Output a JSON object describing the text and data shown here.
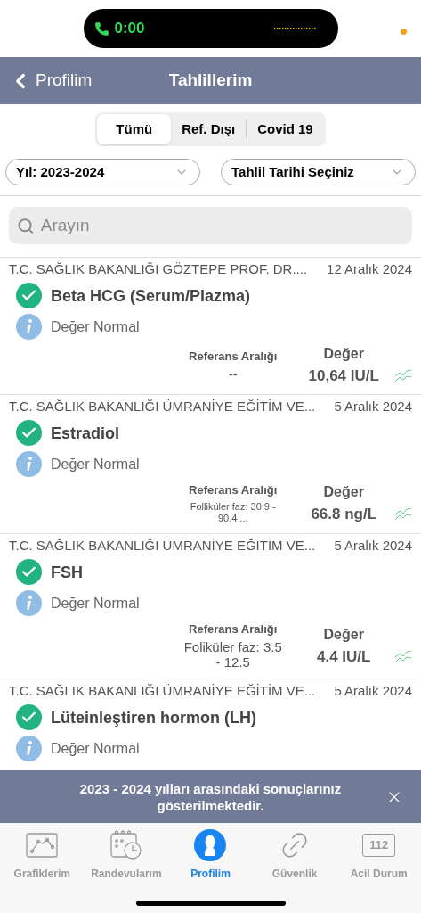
{
  "status_bar": {
    "call_time": "0:00"
  },
  "header": {
    "back_label": "Profilim",
    "title": "Tahlillerim"
  },
  "tabs": [
    {
      "label": "Tümü",
      "selected": true
    },
    {
      "label": "Ref. Dışı",
      "selected": false
    },
    {
      "label": "Covid 19",
      "selected": false
    }
  ],
  "filters": [
    {
      "value": "Yıl: 2023-2024"
    },
    {
      "value": "Tahlil Tarihi Seçiniz"
    }
  ],
  "search": {
    "placeholder": "Arayın"
  },
  "results": [
    {
      "institution": "T.C. SAĞLIK BAKANLIĞI GÖZTEPE PROF. DR....",
      "date": "12 Aralık 2024",
      "name": "Beta HCG (Serum/Plazma)",
      "status": "Değer Normal",
      "normal": true,
      "ref_label": "Referans Aralığı",
      "value_label": "Değer",
      "reference": "--",
      "kind": "standard",
      "value": "10,64 IU/L"
    },
    {
      "institution": "T.C. SAĞLIK BAKANLIĞI ÜMRANİYE EĞİTİM VE...",
      "date": "5 Aralık 2024",
      "name": "Estradiol",
      "status": "Değer Normal",
      "normal": true,
      "ref_label": "Referans Aralığı",
      "value_label": "Değer",
      "reference": "Folliküler faz: 30.9 - 90.4 ...",
      "kind": "compact",
      "value": "66.8 ng/L"
    },
    {
      "institution": "T.C. SAĞLIK BAKANLIĞI ÜMRANİYE EĞİTİM VE...",
      "date": "5 Aralık 2024",
      "name": "FSH",
      "status": "Değer Normal",
      "normal": true,
      "ref_label": "Referans Aralığı",
      "value_label": "Değer",
      "reference": "Foliküler faz: 3.5 - 12.5",
      "kind": "standard",
      "value": "4.4 IU/L"
    },
    {
      "institution": "T.C. SAĞLIK BAKANLIĞI ÜMRANİYE EĞİTİM VE...",
      "date": "5 Aralık 2024",
      "name": "Lüteinleştiren hormon (LH)",
      "status": "Değer Normal",
      "normal": true
    }
  ],
  "banner": {
    "message": "2023 - 2024 yılları arasındaki sonuçlarınız gösterilmektedir."
  },
  "nav": [
    {
      "label": "Grafiklerim",
      "kind": "chart",
      "selected": false
    },
    {
      "label": "Randevularım",
      "kind": "calendar",
      "selected": false
    },
    {
      "label": "Profilim",
      "kind": "person",
      "selected": true
    },
    {
      "label": "Güvenlik",
      "kind": "link",
      "selected": false
    },
    {
      "label": "Acil Durum",
      "kind": "number",
      "badge": "112",
      "selected": false
    }
  ]
}
